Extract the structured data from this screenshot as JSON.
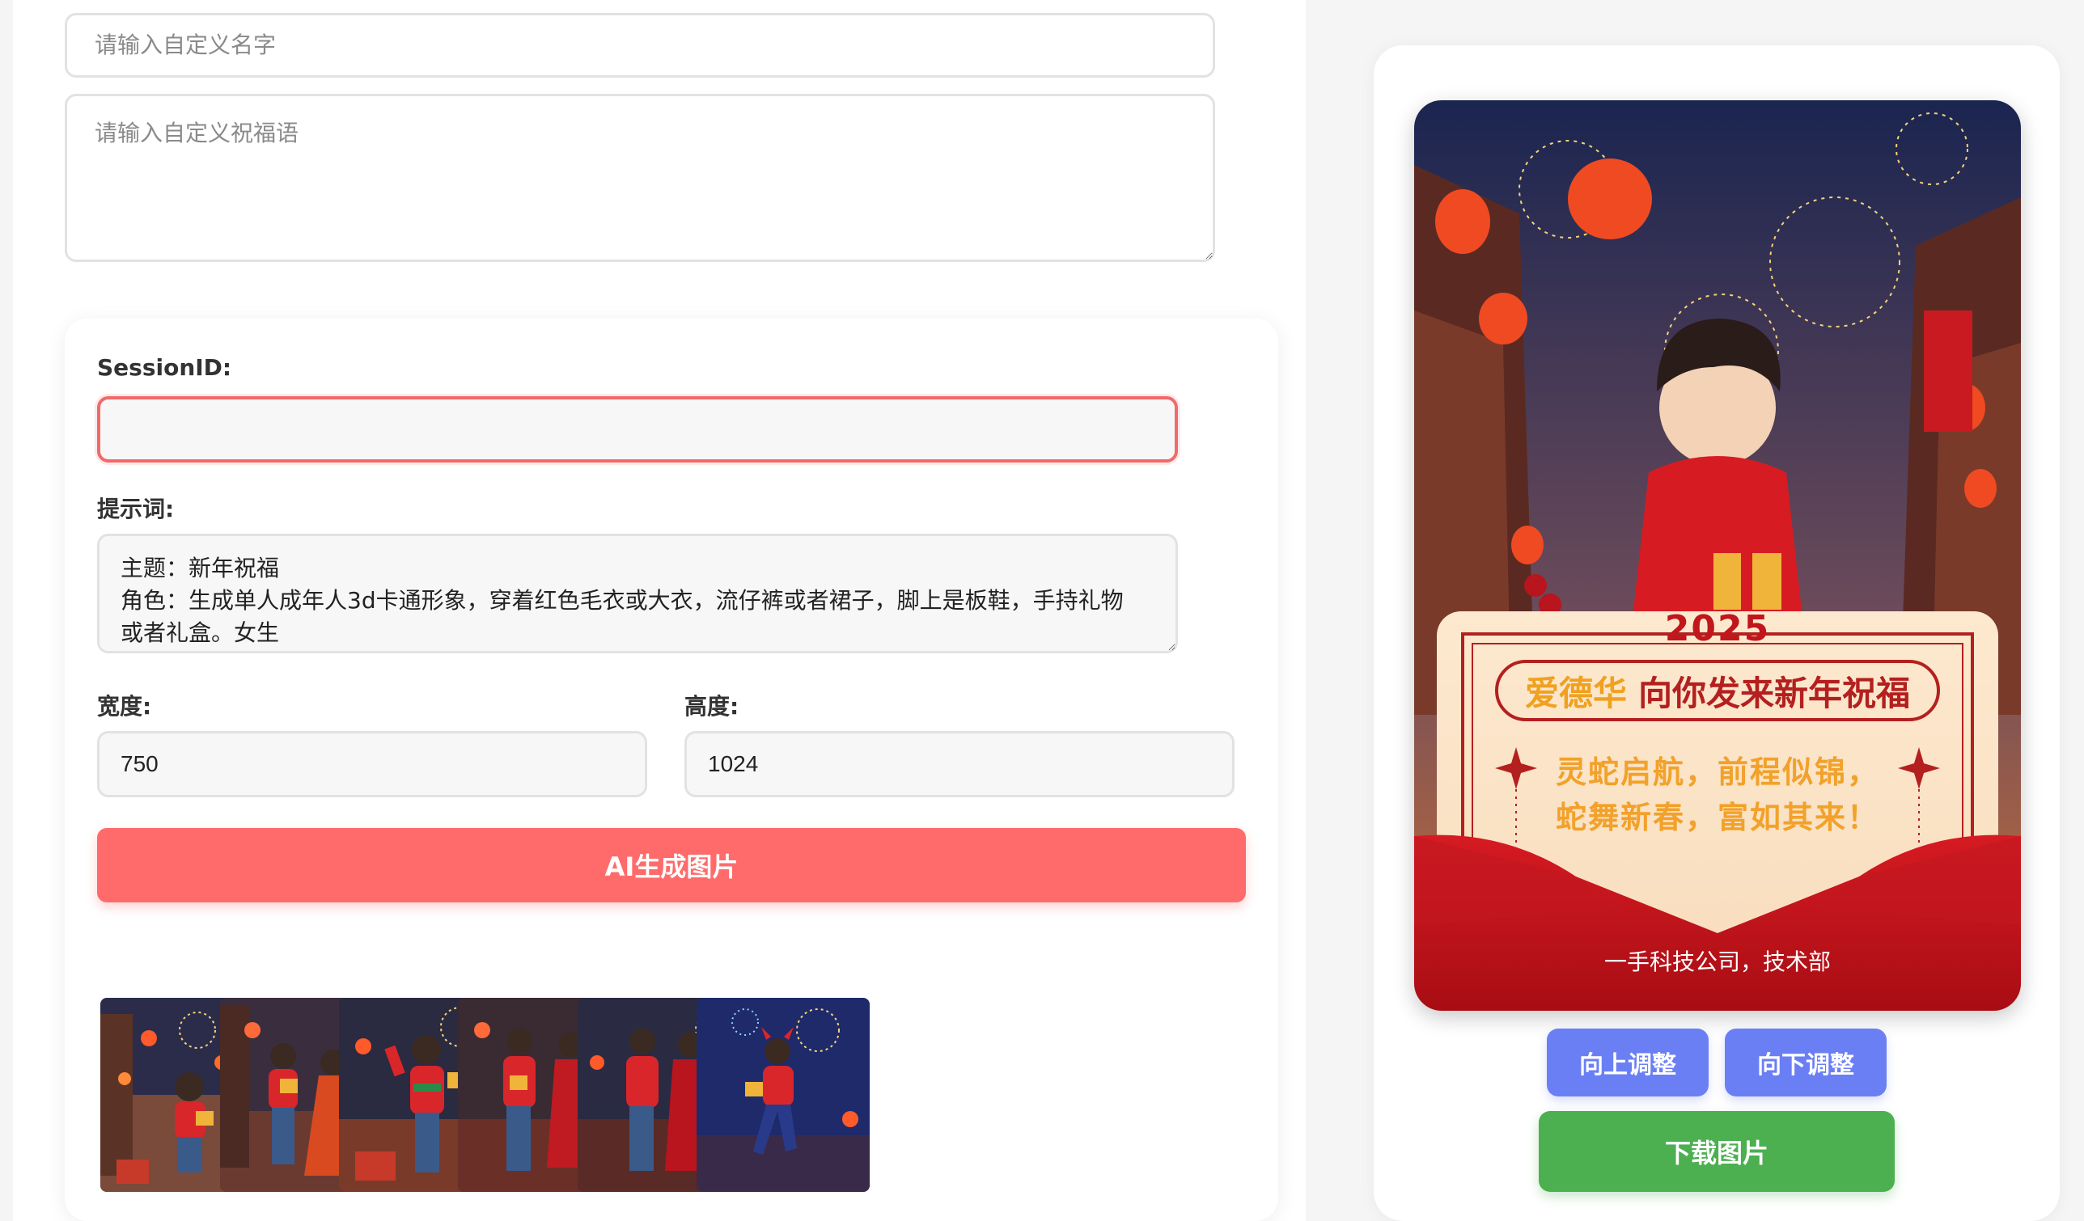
{
  "form": {
    "name_placeholder": "请输入自定义名字",
    "name_value": "",
    "wish_placeholder": "请输入自定义祝福语",
    "wish_value": ""
  },
  "generator": {
    "session_label": "SessionID:",
    "session_value": "",
    "prompt_label": "提示词:",
    "prompt_value": "主题：新年祝福\n角色：生成单人成年人3d卡通形象，穿着红色毛衣或大衣，流仔裤或者裙子，脚上是板鞋，手持礼物或者礼盒。女生",
    "width_label": "宽度:",
    "width_value": "750",
    "height_label": "高度:",
    "height_value": "1024",
    "generate_button": "AI生成图片"
  },
  "gallery": {
    "thumbnails": [
      {
        "scene": "boy-with-firecrackers-street"
      },
      {
        "scene": "couple-with-gifts-street"
      },
      {
        "scene": "boy-waving-fireworks"
      },
      {
        "scene": "couple-with-gifts-lanterns"
      },
      {
        "scene": "couple-with-gifts-night"
      },
      {
        "scene": "boy-dancing-blue-night"
      }
    ]
  },
  "poster": {
    "year": "2025",
    "name": "爱德华",
    "title_suffix": "向你发来新年祝福",
    "wish_line1": "灵蛇启航，前程似锦，",
    "wish_line2": "蛇舞新春，富如其来！",
    "signature": "一手科技公司，技术部"
  },
  "actions": {
    "move_up": "向上调整",
    "move_down": "向下调整",
    "download": "下载图片"
  },
  "colors": {
    "accent_red": "#ff6b6b",
    "adjust_blue": "#6b7ff5",
    "download_green": "#4caf50"
  }
}
